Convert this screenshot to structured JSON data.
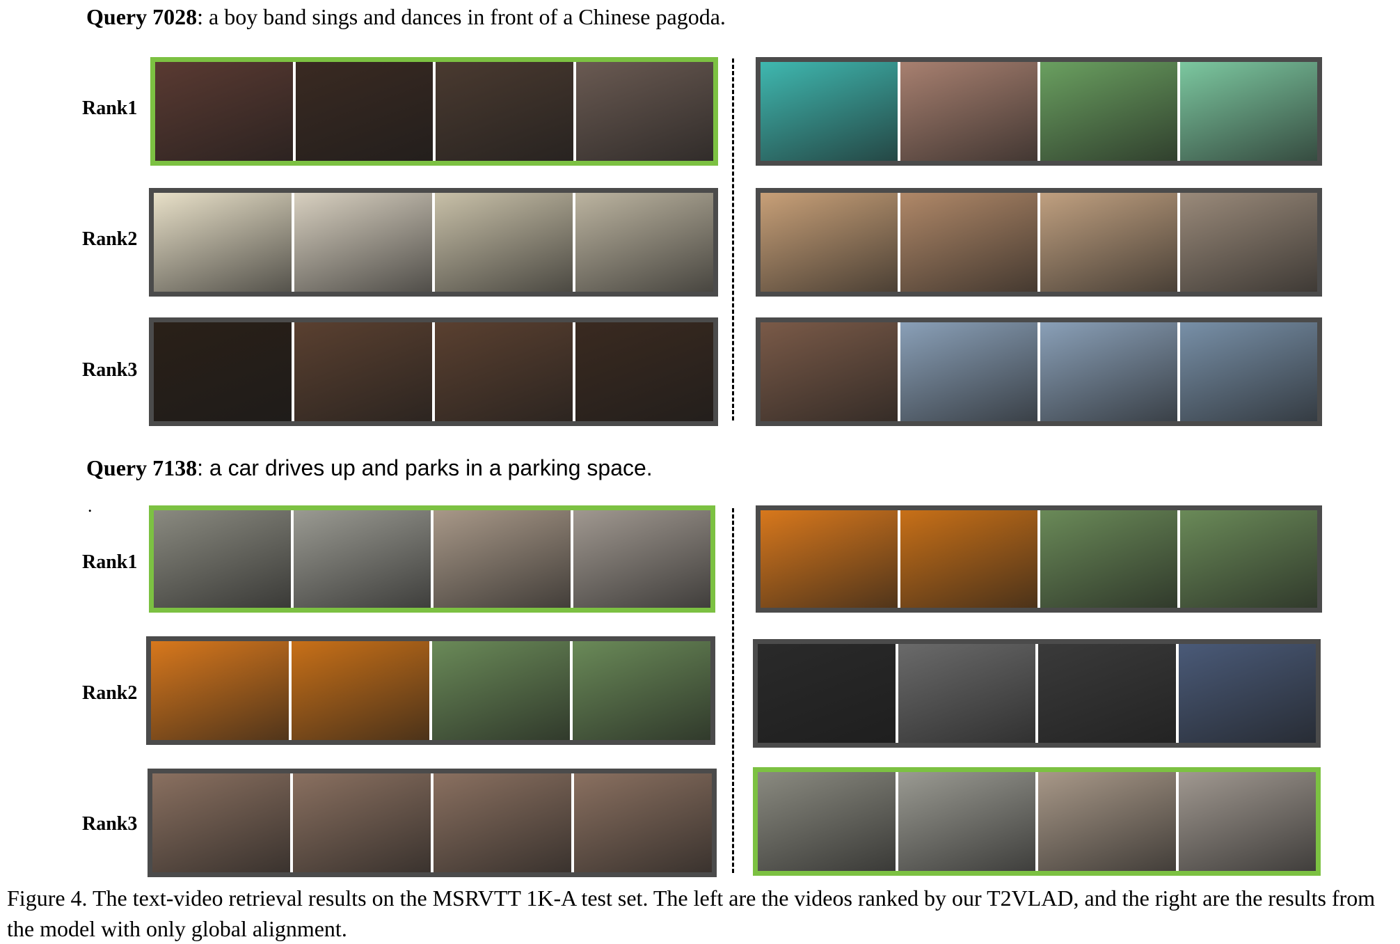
{
  "figure": {
    "queries": [
      {
        "id_label": "Query 7028",
        "text": ": a boy band sings and dances in front of a Chinese pagoda.",
        "rows": [
          {
            "rank": "Rank1",
            "left": {
              "border": "green",
              "frames": [
                "#5a3a32",
                "#3a2a22",
                "#4a3a30",
                "#6a5a52"
              ]
            },
            "right": {
              "border": "gray",
              "frames": [
                "#3fb8b0",
                "#a88070",
                "#6aa060",
                "#7cc8a0"
              ]
            }
          },
          {
            "rank": "Rank2",
            "left": {
              "border": "gray",
              "frames": [
                "#e8e0c8",
                "#d8d0c0",
                "#c8c0a8",
                "#bcb4a0"
              ]
            },
            "right": {
              "border": "gray",
              "frames": [
                "#c8a078",
                "#b08868",
                "#c0a080",
                "#9a8a7a"
              ]
            }
          },
          {
            "rank": "Rank3",
            "left": {
              "border": "gray",
              "frames": [
                "#2a2018",
                "#5a4030",
                "#5a4030",
                "#3a2a20"
              ]
            },
            "right": {
              "border": "gray",
              "frames": [
                "#7a5a48",
                "#8aa0b8",
                "#8aa0b8",
                "#7890a8"
              ]
            }
          }
        ]
      },
      {
        "id_label": "Query 7138",
        "text": ": a car drives up and parks in a parking space.",
        "rows": [
          {
            "rank": "Rank1",
            "left": {
              "border": "green",
              "frames": [
                "#8a8a80",
                "#9a9a92",
                "#a89888",
                "#a09890"
              ]
            },
            "right": {
              "border": "gray",
              "frames": [
                "#d8781c",
                "#c87018",
                "#6a8a58",
                "#6a8a58"
              ]
            }
          },
          {
            "rank": "Rank2",
            "left": {
              "border": "gray",
              "frames": [
                "#d8781c",
                "#c87018",
                "#6a8a58",
                "#6a8a58"
              ]
            },
            "right": {
              "border": "gray",
              "frames": [
                "#2a2a2a",
                "#6a6a6a",
                "#3a3a3a",
                "#4a5a78"
              ]
            }
          },
          {
            "rank": "Rank3",
            "left": {
              "border": "gray",
              "frames": [
                "#8a7060",
                "#8a7060",
                "#8a7060",
                "#8a7060"
              ]
            },
            "right": {
              "border": "green",
              "frames": [
                "#8a8a80",
                "#9a9a92",
                "#a89888",
                "#a09890"
              ]
            }
          }
        ]
      }
    ],
    "dot": ".",
    "caption": "Figure 4. The text-video retrieval results on the MSRVTT 1K-A test set. The left are the videos ranked by our T2VLAD, and the right are the results from the model with only global alignment."
  }
}
